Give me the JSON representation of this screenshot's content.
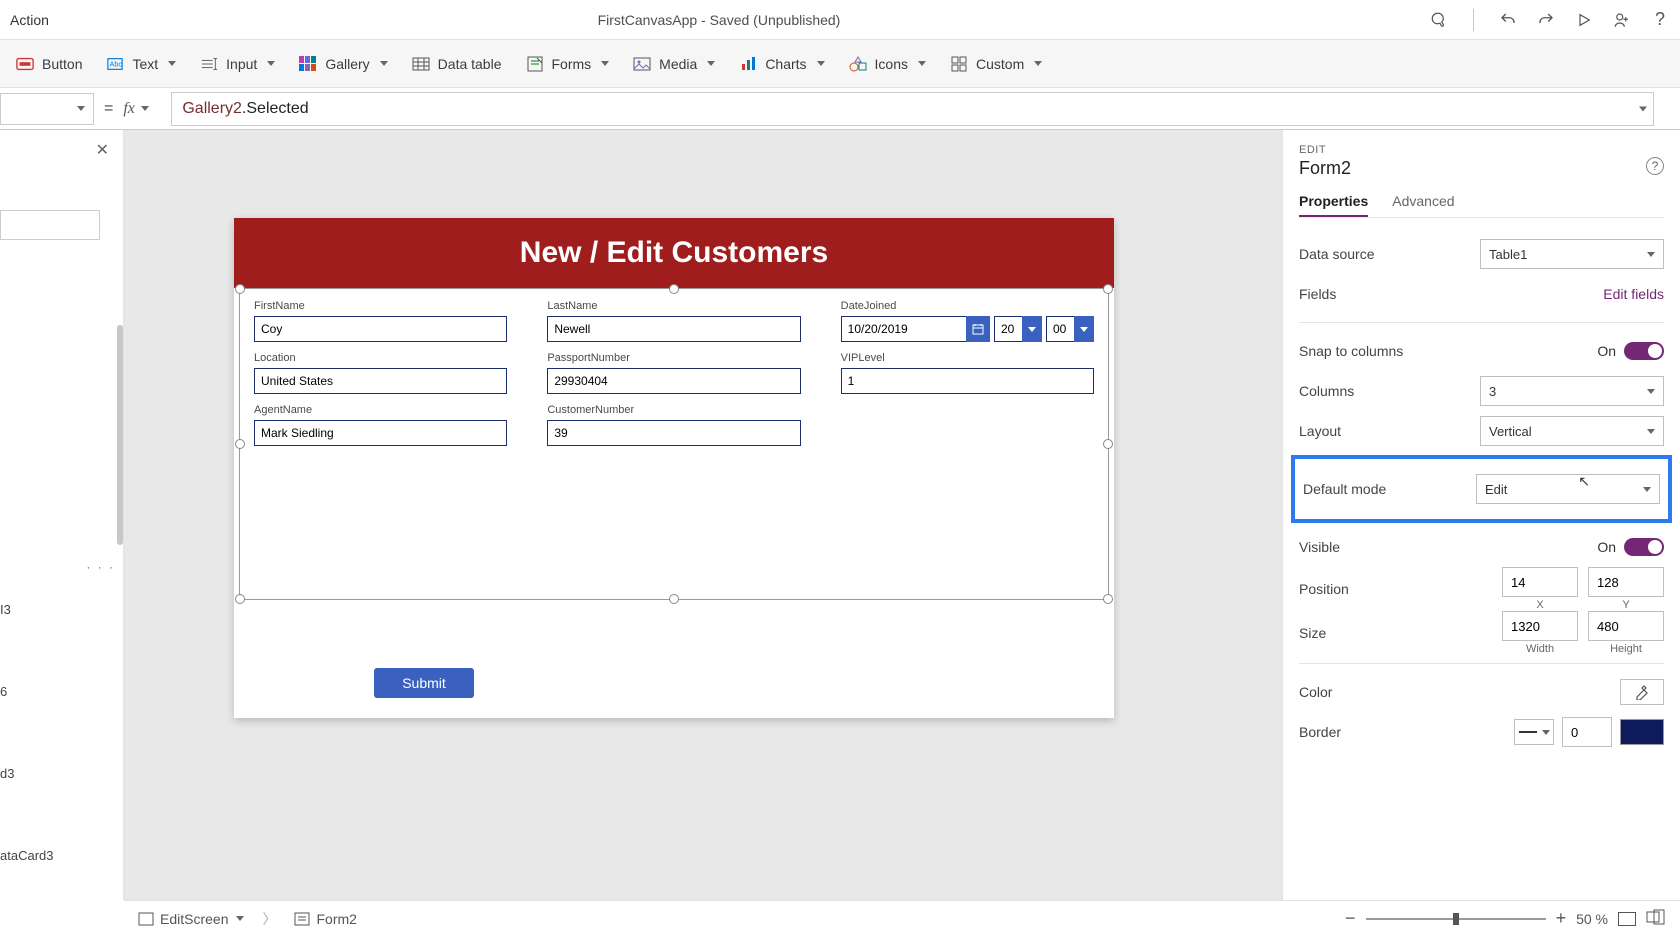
{
  "title_bar": {
    "menu_left": "Action",
    "app_status": "FirstCanvasApp - Saved (Unpublished)"
  },
  "ribbon": {
    "button": "Button",
    "text": "Text",
    "input": "Input",
    "gallery": "Gallery",
    "data_table": "Data table",
    "forms": "Forms",
    "media": "Media",
    "charts": "Charts",
    "icons": "Icons",
    "custom": "Custom"
  },
  "formula": {
    "object": "Gallery2",
    "property": ".Selected"
  },
  "left_tree": {
    "item1": "I3",
    "item2": "6",
    "item3": "d3",
    "item4": "ataCard3"
  },
  "canvas": {
    "header": "New / Edit Customers",
    "fields": {
      "first_name_label": "FirstName",
      "first_name_value": "Coy",
      "last_name_label": "LastName",
      "last_name_value": "Newell",
      "date_joined_label": "DateJoined",
      "date_joined_value": "10/20/2019",
      "date_hour": "20",
      "date_min": "00",
      "location_label": "Location",
      "location_value": "United States",
      "passport_label": "PassportNumber",
      "passport_value": "29930404",
      "vip_label": "VIPLevel",
      "vip_value": "1",
      "agent_label": "AgentName",
      "agent_value": "Mark Siedling",
      "customer_num_label": "CustomerNumber",
      "customer_num_value": "39"
    },
    "submit": "Submit"
  },
  "props": {
    "section": "EDIT",
    "object": "Form2",
    "tab_properties": "Properties",
    "tab_advanced": "Advanced",
    "data_source_label": "Data source",
    "data_source_value": "Table1",
    "fields_label": "Fields",
    "fields_link": "Edit fields",
    "snap_label": "Snap to columns",
    "snap_state": "On",
    "columns_label": "Columns",
    "columns_value": "3",
    "layout_label": "Layout",
    "layout_value": "Vertical",
    "default_mode_label": "Default mode",
    "default_mode_value": "Edit",
    "visible_label": "Visible",
    "visible_state": "On",
    "position_label": "Position",
    "pos_x": "14",
    "pos_y": "128",
    "pos_x_lbl": "X",
    "pos_y_lbl": "Y",
    "size_label": "Size",
    "size_w": "1320",
    "size_h": "480",
    "size_w_lbl": "Width",
    "size_h_lbl": "Height",
    "color_label": "Color",
    "border_label": "Border",
    "border_width": "0"
  },
  "footer": {
    "screen": "EditScreen",
    "obj": "Form2",
    "zoom": "50  %"
  }
}
